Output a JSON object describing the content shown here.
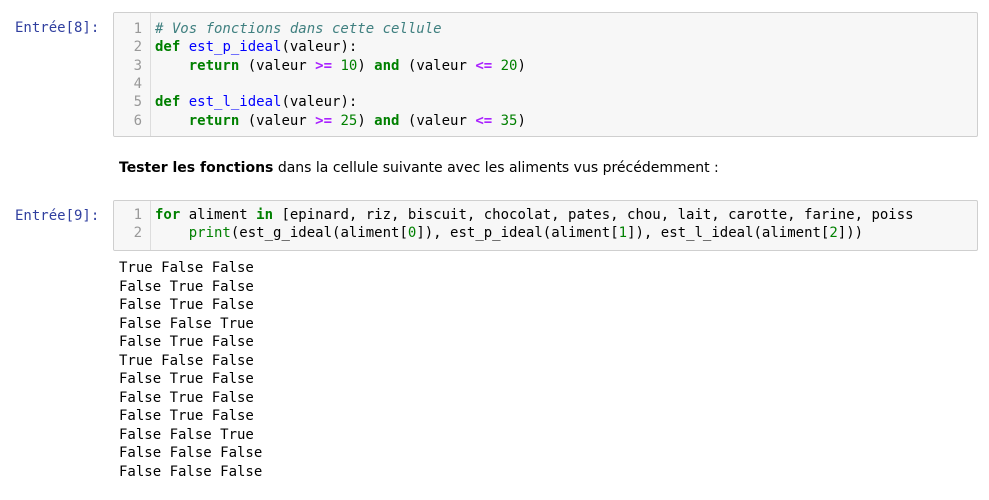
{
  "cells": [
    {
      "prompt": "Entrée[8]:",
      "lines": [
        {
          "n": "1",
          "tokens": [
            {
              "t": "# Vos fonctions dans cette cellule",
              "c": "cm-comment"
            }
          ]
        },
        {
          "n": "2",
          "tokens": [
            {
              "t": "def",
              "c": "cm-kw"
            },
            {
              "t": " ",
              "c": ""
            },
            {
              "t": "est_p_ideal",
              "c": "cm-def"
            },
            {
              "t": "(valeur):",
              "c": ""
            }
          ]
        },
        {
          "n": "3",
          "tokens": [
            {
              "t": "    ",
              "c": ""
            },
            {
              "t": "return",
              "c": "cm-kw"
            },
            {
              "t": " (valeur ",
              "c": ""
            },
            {
              "t": ">=",
              "c": "cm-op"
            },
            {
              "t": " ",
              "c": ""
            },
            {
              "t": "10",
              "c": "cm-num"
            },
            {
              "t": ") ",
              "c": ""
            },
            {
              "t": "and",
              "c": "cm-kw"
            },
            {
              "t": " (valeur ",
              "c": ""
            },
            {
              "t": "<=",
              "c": "cm-op"
            },
            {
              "t": " ",
              "c": ""
            },
            {
              "t": "20",
              "c": "cm-num"
            },
            {
              "t": ")",
              "c": ""
            }
          ]
        },
        {
          "n": "4",
          "tokens": []
        },
        {
          "n": "5",
          "tokens": [
            {
              "t": "def",
              "c": "cm-kw"
            },
            {
              "t": " ",
              "c": ""
            },
            {
              "t": "est_l_ideal",
              "c": "cm-def"
            },
            {
              "t": "(valeur):",
              "c": ""
            }
          ]
        },
        {
          "n": "6",
          "tokens": [
            {
              "t": "    ",
              "c": ""
            },
            {
              "t": "return",
              "c": "cm-kw"
            },
            {
              "t": " (valeur ",
              "c": ""
            },
            {
              "t": ">=",
              "c": "cm-op"
            },
            {
              "t": " ",
              "c": ""
            },
            {
              "t": "25",
              "c": "cm-num"
            },
            {
              "t": ") ",
              "c": ""
            },
            {
              "t": "and",
              "c": "cm-kw"
            },
            {
              "t": " (valeur ",
              "c": ""
            },
            {
              "t": "<=",
              "c": "cm-op"
            },
            {
              "t": " ",
              "c": ""
            },
            {
              "t": "35",
              "c": "cm-num"
            },
            {
              "t": ")",
              "c": ""
            }
          ]
        }
      ]
    },
    {
      "prompt": "Entrée[9]:",
      "lines": [
        {
          "n": "1",
          "tokens": [
            {
              "t": "for",
              "c": "cm-kw"
            },
            {
              "t": " aliment ",
              "c": ""
            },
            {
              "t": "in",
              "c": "cm-kw"
            },
            {
              "t": " [epinard, riz, biscuit, chocolat, pates, chou, lait, carotte, farine, poiss",
              "c": ""
            }
          ]
        },
        {
          "n": "2",
          "tokens": [
            {
              "t": "    ",
              "c": ""
            },
            {
              "t": "print",
              "c": "cm-builtin"
            },
            {
              "t": "(est_g_ideal(aliment[",
              "c": ""
            },
            {
              "t": "0",
              "c": "cm-num"
            },
            {
              "t": "]), est_p_ideal(aliment[",
              "c": ""
            },
            {
              "t": "1",
              "c": "cm-num"
            },
            {
              "t": "]), est_l_ideal(aliment[",
              "c": ""
            },
            {
              "t": "2",
              "c": "cm-num"
            },
            {
              "t": "]))",
              "c": ""
            }
          ]
        }
      ]
    }
  ],
  "markdown": {
    "bold": "Tester les fonctions",
    "rest": " dans la cellule suivante avec les aliments vus précédemment :"
  },
  "output": [
    "True False False",
    "False True False",
    "False True False",
    "False False True",
    "False True False",
    "True False False",
    "False True False",
    "False True False",
    "False True False",
    "False False True",
    "False False False",
    "False False False"
  ]
}
